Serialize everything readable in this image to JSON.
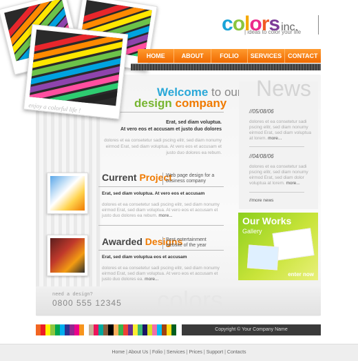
{
  "logo": {
    "letters": [
      {
        "ch": "c",
        "color": "#1aa4d8"
      },
      {
        "ch": "o",
        "color": "#8bc53f"
      },
      {
        "ch": "l",
        "color": "#f5a800"
      },
      {
        "ch": "o",
        "color": "#ec2a8b"
      },
      {
        "ch": "r",
        "color": "#f15a24"
      },
      {
        "ch": "s",
        "color": "#7d3c98"
      }
    ],
    "suffix": "inc.",
    "tagline": "| ideas to color your life"
  },
  "photos": {
    "caption": "enjoy a colorful life !"
  },
  "nav": {
    "items": [
      {
        "label": "HOME"
      },
      {
        "label": "ABOUT"
      },
      {
        "label": "FOLIO"
      },
      {
        "label": "SERVICES"
      },
      {
        "label": "CONTACT"
      }
    ]
  },
  "welcome": {
    "line1_a": "Welcome",
    "line1_b": " to our",
    "line2_a": "design",
    "line2_b": " company",
    "bold1": "Erat, sed diam voluptua.",
    "bold2": "At vero eos et accusam et justo duo dolores",
    "body": "dolores et ea consetetur sadi pscing elitr, sed diam nonumy eirmod Erat, sed diam voluptua. At vero eos et accusam et justo duo dolores ea rebum."
  },
  "news": {
    "title": "News",
    "items": [
      {
        "date": "//05/08/06",
        "text": "dolores et ea consetetur sadi pscing elitr, sed diam nonumy eirmod Erat, sed diam voluptua at lorem.",
        "more": "more..."
      },
      {
        "date": "//04/08/06",
        "text": "dolores et ea consetetur sadi pscing elitr, sed diam nonumy eirmod Erat, sed diam dolor voluptua at lorem.",
        "more": "more..."
      }
    ],
    "more_news": "//more news"
  },
  "sections": [
    {
      "title_a": "Current",
      "title_b": "Project",
      "sub": "Web page design for a business company",
      "bold": "Erat, sed diam voluptua. At vero eos et accusam",
      "body": "dolores et ea consetetur sadi pscing elitr, sed diam nonumy eirmod Erat, sed diam voluptua. At vero eos et accusam et justo duo dolores ea rebum.",
      "more": "more..."
    },
    {
      "title_a": "Awarded",
      "title_b": "Designs",
      "sub": "Best entertainment website of the year",
      "bold": "Erat, sed diam voluptua eos et accusam",
      "body": "dolores et ea consetetur sadi pscing elitr, sed diam nonumy eirmod Erat, sed diam voluptua. At vero eos et accusam et justo duo dolores ea.",
      "more": "more..."
    }
  ],
  "works": {
    "title": "Our Works",
    "sub": "Gallery",
    "enter": "enter now"
  },
  "contact": {
    "prompt": "need a design?",
    "phone": "0800 555 12345",
    "ghost": "colors"
  },
  "footer": {
    "copyright": "Copyright © Your Company Name",
    "links": [
      {
        "label": "Home"
      },
      {
        "label": "About Us"
      },
      {
        "label": "Folio"
      },
      {
        "label": "Services"
      },
      {
        "label": "Prices"
      },
      {
        "label": "Support"
      },
      {
        "label": "Contacts"
      }
    ],
    "separator": "|",
    "swatches": [
      "#f26522",
      "#ed1c24",
      "#fff200",
      "#8dc63f",
      "#00a651",
      "#00aeef",
      "#2e3192",
      "#92278f",
      "#ec008c",
      "#f7941d",
      "#ffffff",
      "#c7b299",
      "#ed145b",
      "#00a99d",
      "#8b5e3c",
      "#000000",
      "#fbaf5d",
      "#39b54a",
      "#ef4136",
      "#662d91",
      "#f9ed32",
      "#3cb878",
      "#1b1464",
      "#d7df23",
      "#f06eaa",
      "#00bff3",
      "#a0410d",
      "#ffde17",
      "#005e20"
    ]
  },
  "pencil_colors": [
    "#e8262c",
    "#ff8a00",
    "#ffe600",
    "#6cc24a",
    "#00a3e0",
    "#8e44ad",
    "#ff4fa0",
    "#2ecc71",
    "#222222"
  ]
}
